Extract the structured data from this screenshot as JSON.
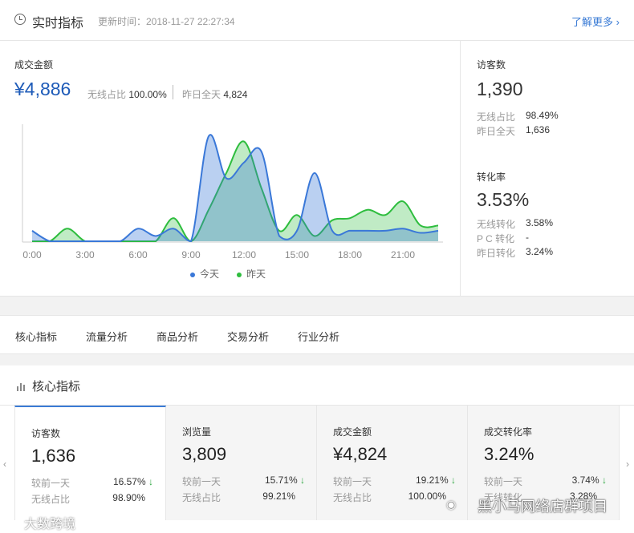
{
  "header": {
    "title": "实时指标",
    "updated": "更新时间：2018-11-27 22:27:34",
    "more": "了解更多 ›"
  },
  "sales": {
    "label": "成交金额",
    "value": "¥4,886",
    "wireless_label": "无线占比",
    "wireless_value": "100.00%",
    "yesterday_label": "昨日全天",
    "yesterday_value": "4,824"
  },
  "visitors": {
    "label": "访客数",
    "value": "1,390",
    "wireless_label": "无线占比",
    "wireless_value": "98.49%",
    "yesterday_label": "昨日全天",
    "yesterday_value": "1,636"
  },
  "conversion": {
    "label": "转化率",
    "value": "3.53%",
    "wireless_label": "无线转化",
    "wireless_value": "3.58%",
    "pc_label": "P C 转化",
    "pc_value": "-",
    "yesterday_label": "昨日转化",
    "yesterday_value": "3.24%"
  },
  "chart_data": {
    "type": "area",
    "x_ticks": [
      "0:00",
      "3:00",
      "6:00",
      "9:00",
      "12:00",
      "15:00",
      "18:00",
      "21:00"
    ],
    "x": [
      0,
      1,
      2,
      3,
      4,
      5,
      6,
      7,
      8,
      9,
      10,
      11,
      12,
      13,
      14,
      15,
      16,
      17,
      18,
      19,
      20,
      21,
      22,
      23
    ],
    "series": [
      {
        "name": "今天",
        "color": "#3a78d8",
        "values": [
          10,
          0,
          0,
          0,
          0,
          0,
          12,
          5,
          12,
          0,
          100,
          60,
          75,
          85,
          5,
          10,
          65,
          10,
          10,
          10,
          10,
          12,
          8,
          10
        ]
      },
      {
        "name": "昨天",
        "color": "#2ebd3e",
        "values": [
          0,
          0,
          12,
          0,
          0,
          0,
          0,
          0,
          22,
          0,
          30,
          65,
          95,
          50,
          10,
          25,
          5,
          20,
          22,
          30,
          25,
          38,
          15,
          15
        ]
      }
    ],
    "legend": "bottom"
  },
  "tabs": [
    "核心指标",
    "流量分析",
    "商品分析",
    "交易分析",
    "行业分析"
  ],
  "core": {
    "title": "核心指标",
    "cards": [
      {
        "name": "访客数",
        "value": "1,636",
        "compare_label": "较前一天",
        "compare_value": "16.57%",
        "arrow": "↓",
        "ratio_label": "无线占比",
        "ratio_value": "98.90%"
      },
      {
        "name": "浏览量",
        "value": "3,809",
        "compare_label": "较前一天",
        "compare_value": "15.71%",
        "arrow": "↓",
        "ratio_label": "无线占比",
        "ratio_value": "99.21%"
      },
      {
        "name": "成交金额",
        "value": "¥4,824",
        "compare_label": "较前一天",
        "compare_value": "19.21%",
        "arrow": "↓",
        "ratio_label": "无线占比",
        "ratio_value": "100.00%"
      },
      {
        "name": "成交转化率",
        "value": "3.24%",
        "compare_label": "较前一天",
        "compare_value": "3.74%",
        "arrow": "↓",
        "ratio_label": "无线转化",
        "ratio_value": "3.28%"
      }
    ]
  },
  "nav": {
    "prev": "‹",
    "next": "›"
  },
  "watermark": {
    "wechat": "黑小马网络店群项目",
    "bottom": "大数跨境"
  },
  "colors": {
    "accent": "#3a7bd5",
    "today": "#3a78d8",
    "yesterday": "#2ebd3e",
    "down": "#2da641"
  }
}
